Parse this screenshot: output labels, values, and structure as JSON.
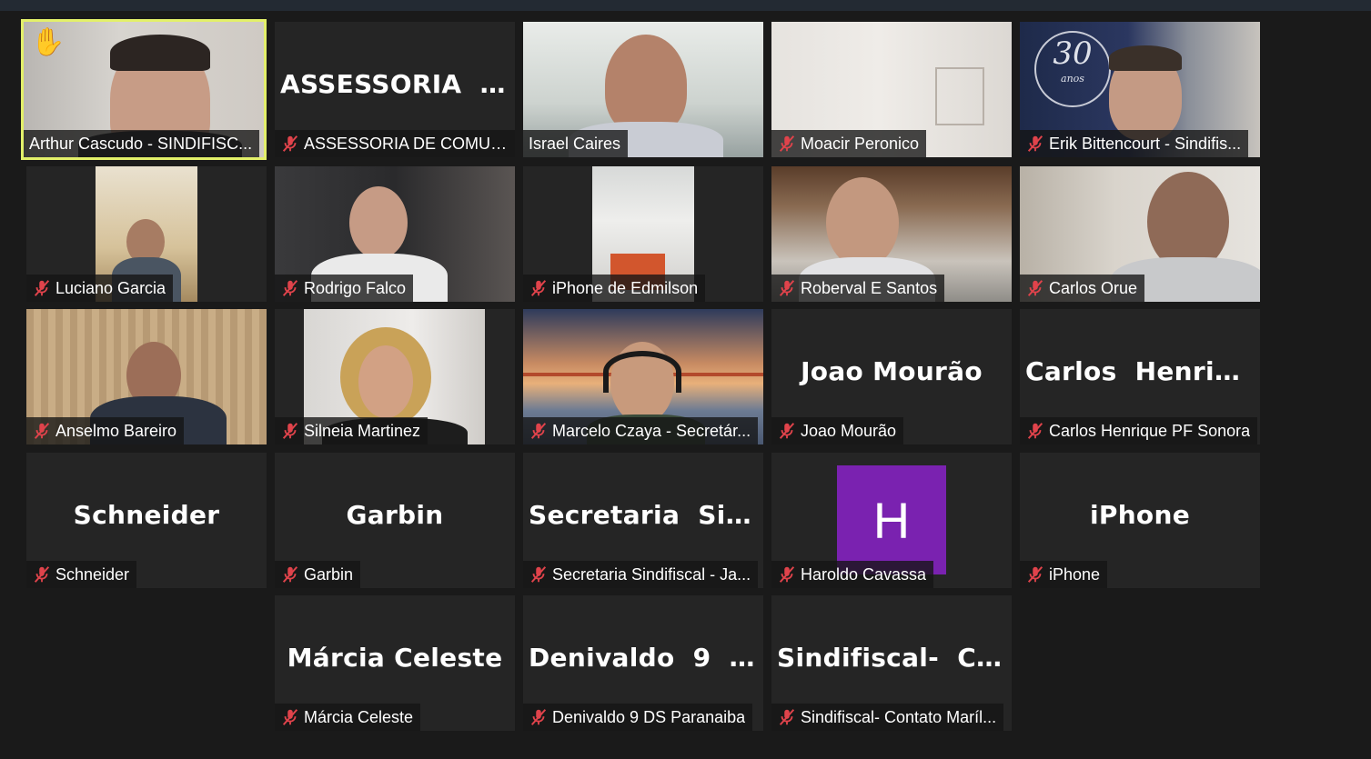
{
  "participants": [
    {
      "name": "Arthur Cascudo - SINDIFISC...",
      "display": "",
      "hand": "✋",
      "muted": false,
      "active": true
    },
    {
      "name": "ASSESSORIA DE COMUNI...",
      "display": "ASSESSORIA  DE...",
      "muted": true
    },
    {
      "name": "Israel Caires",
      "display": "",
      "muted": false
    },
    {
      "name": "Moacir Peronico",
      "display": "",
      "muted": true
    },
    {
      "name": "Erik Bittencourt - Sindifis...",
      "display": "",
      "logo_text": "30",
      "logo_sub": "anos",
      "muted": true
    },
    {
      "name": "Luciano Garcia",
      "display": "",
      "muted": true
    },
    {
      "name": "Rodrigo Falco",
      "display": "",
      "muted": true
    },
    {
      "name": "iPhone de Edmilson",
      "display": "",
      "muted": true
    },
    {
      "name": "Roberval E Santos",
      "display": "",
      "muted": true
    },
    {
      "name": "Carlos Orue",
      "display": "",
      "muted": true
    },
    {
      "name": "Anselmo Bareiro",
      "display": "",
      "muted": true
    },
    {
      "name": "Silneia Martinez",
      "display": "",
      "muted": true
    },
    {
      "name": "Marcelo Czaya - Secretár...",
      "display": "",
      "muted": true
    },
    {
      "name": "Joao Mourão",
      "display": "Joao Mourão",
      "muted": true
    },
    {
      "name": "Carlos Henrique PF Sonora",
      "display": "Carlos  Henriqu...",
      "muted": true
    },
    {
      "name": "Schneider",
      "display": "Schneider",
      "muted": true
    },
    {
      "name": "Garbin",
      "display": "Garbin",
      "muted": true
    },
    {
      "name": "Secretaria Sindifiscal - Ja...",
      "display": "Secretaria  Sindi...",
      "muted": true
    },
    {
      "name": "Haroldo Cavassa",
      "display": "",
      "avatar_letter": "H",
      "muted": true
    },
    {
      "name": "iPhone",
      "display": "iPhone",
      "muted": true
    },
    {
      "name": "Márcia Celeste",
      "display": "Márcia Celeste",
      "muted": true
    },
    {
      "name": "Denivaldo 9 DS Paranaiba",
      "display": "Denivaldo  9  DS...",
      "muted": true
    },
    {
      "name": "Sindifiscal- Contato Maríl...",
      "display": "Sindifiscal-  Con...",
      "muted": true
    }
  ],
  "colors": {
    "background": "#1a1a1a",
    "tile": "#252525",
    "active_border": "#e3f06a",
    "muted_icon": "#e0434b",
    "avatar": "#7a22b0"
  }
}
